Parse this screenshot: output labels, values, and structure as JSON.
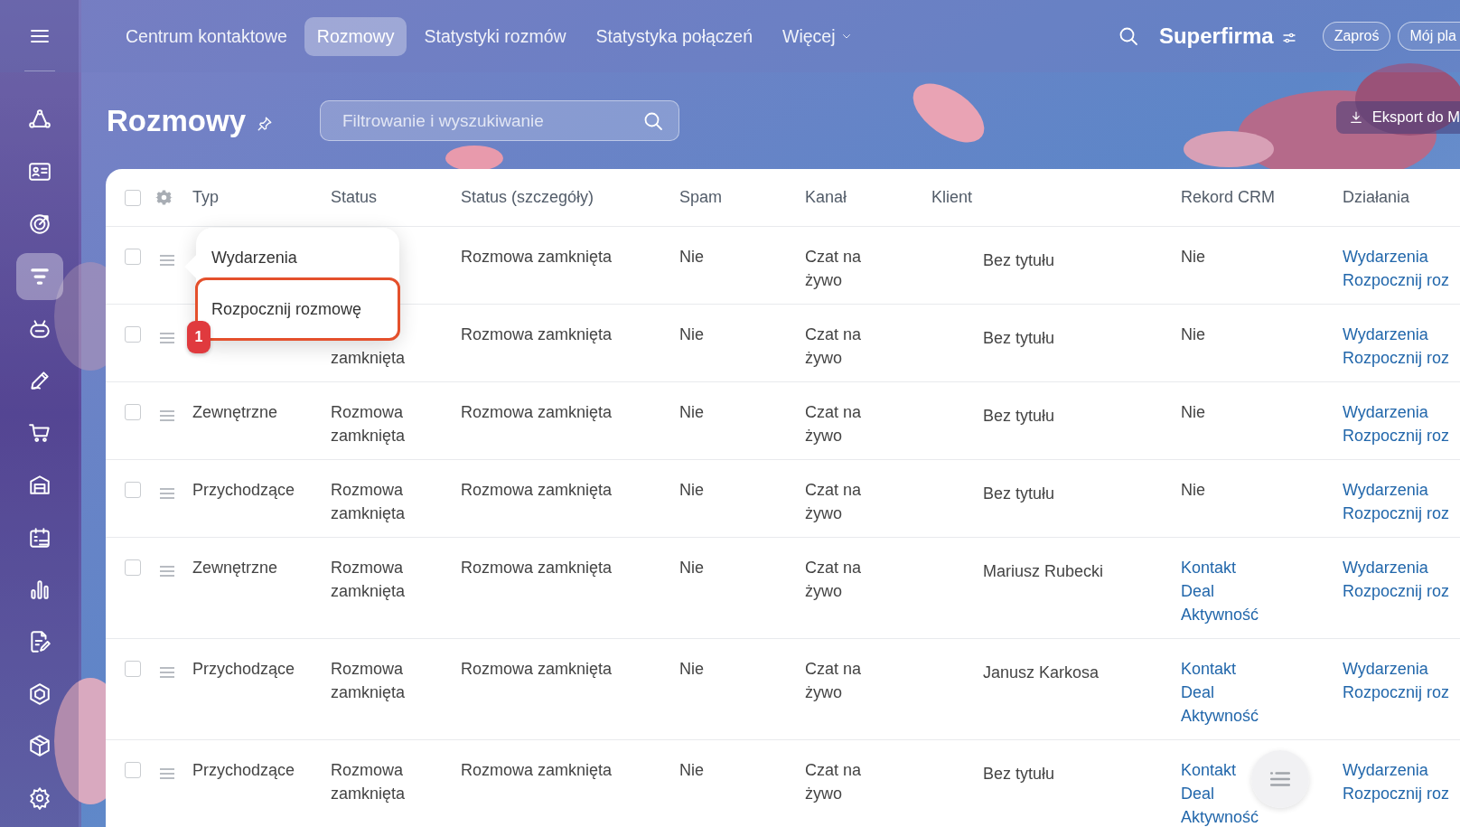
{
  "sidebar": {
    "items": [
      {
        "selected": false
      },
      {
        "selected": false
      },
      {
        "selected": false
      },
      {
        "selected": true
      },
      {
        "selected": false
      },
      {
        "selected": false
      },
      {
        "selected": false
      },
      {
        "selected": false
      },
      {
        "selected": false
      },
      {
        "selected": false
      },
      {
        "selected": false
      },
      {
        "selected": false
      },
      {
        "selected": false
      },
      {
        "selected": false
      }
    ]
  },
  "topbar": {
    "tabs": [
      {
        "label": "Centrum kontaktowe",
        "selected": false,
        "kind": "plain"
      },
      {
        "label": "Rozmowy",
        "selected": true,
        "kind": "plain"
      },
      {
        "label": "Statystyki rozmów",
        "selected": false,
        "kind": "plain"
      },
      {
        "label": "Statystyka połączeń",
        "selected": false,
        "kind": "plain"
      },
      {
        "label": "Więcej",
        "selected": false,
        "kind": "dropdown"
      }
    ],
    "company": "Superfirma",
    "buttons": [
      "Zaproś",
      "Mój pla"
    ]
  },
  "page": {
    "title": "Rozmowy",
    "search": {
      "placeholder": "Filtrowanie i wyszukiwanie"
    },
    "export_button": "Eksport do M"
  },
  "table": {
    "header_checked": false,
    "columns": [
      "Typ",
      "Status",
      "Status (szczegóły)",
      "Spam",
      "Kanał",
      "Klient",
      "Rekord CRM",
      "Działania"
    ],
    "rows": [
      {
        "checked": false,
        "details": "Rozmowa zamknięta",
        "spam": "Nie",
        "channel": "Czat na żywo",
        "client": "Bez tytułu",
        "crm": [
          {
            "label": "Nie",
            "kind": "text"
          }
        ],
        "actions": [
          "Wydarzenia",
          "Rozpocznij roz"
        ]
      },
      {
        "checked": false,
        "status": "zamknięta",
        "status_cut": true,
        "details": "Rozmowa zamknięta",
        "spam": "Nie",
        "channel": "Czat na żywo",
        "client": "Bez tytułu",
        "crm": [
          {
            "label": "Nie",
            "kind": "text"
          }
        ],
        "actions": [
          "Wydarzenia",
          "Rozpocznij roz"
        ]
      },
      {
        "checked": false,
        "type": "Zewnętrzne",
        "status": "Rozmowa zamknięta",
        "details": "Rozmowa zamknięta",
        "spam": "Nie",
        "channel": "Czat na żywo",
        "client": "Bez tytułu",
        "crm": [
          {
            "label": "Nie",
            "kind": "text"
          }
        ],
        "actions": [
          "Wydarzenia",
          "Rozpocznij roz"
        ]
      },
      {
        "checked": false,
        "type": "Przychodzące",
        "status": "Rozmowa zamknięta",
        "details": "Rozmowa zamknięta",
        "spam": "Nie",
        "channel": "Czat na żywo",
        "client": "Bez tytułu",
        "crm": [
          {
            "label": "Nie",
            "kind": "text"
          }
        ],
        "actions": [
          "Wydarzenia",
          "Rozpocznij roz"
        ]
      },
      {
        "checked": false,
        "type": "Zewnętrzne",
        "status": "Rozmowa zamknięta",
        "details": "Rozmowa zamknięta",
        "spam": "Nie",
        "channel": "Czat na żywo",
        "client": "Mariusz Rubecki",
        "crm": [
          {
            "label": "Kontakt",
            "kind": "link"
          },
          {
            "label": "Deal",
            "kind": "link"
          },
          {
            "label": "Aktywność",
            "kind": "link"
          }
        ],
        "actions": [
          "Wydarzenia",
          "Rozpocznij roz"
        ]
      },
      {
        "checked": false,
        "type": "Przychodzące",
        "status": "Rozmowa zamknięta",
        "details": "Rozmowa zamknięta",
        "spam": "Nie",
        "channel": "Czat na żywo",
        "client": "Janusz Karkosa",
        "crm": [
          {
            "label": "Kontakt",
            "kind": "link"
          },
          {
            "label": "Deal",
            "kind": "link"
          },
          {
            "label": "Aktywność",
            "kind": "link"
          }
        ],
        "actions": [
          "Wydarzenia",
          "Rozpocznij roz"
        ]
      },
      {
        "checked": false,
        "type": "Przychodzące",
        "status": "Rozmowa zamknięta",
        "details": "Rozmowa zamknięta",
        "spam": "Nie",
        "channel": "Czat na żywo",
        "client": "Bez tytułu",
        "crm": [
          {
            "label": "Kontakt",
            "kind": "link"
          },
          {
            "label": "Deal",
            "kind": "link"
          },
          {
            "label": "Aktywność",
            "kind": "link"
          }
        ],
        "actions": [
          "Wydarzenia",
          "Rozpocznij roz"
        ]
      }
    ]
  },
  "popup": {
    "items": [
      {
        "label": "Wydarzenia",
        "outlined": false
      },
      {
        "label": "Rozpocznij rozmowę",
        "outlined": true
      }
    ],
    "badge": "1"
  }
}
